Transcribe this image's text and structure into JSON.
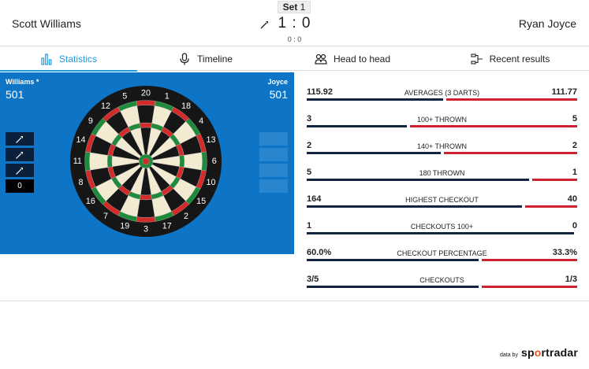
{
  "match": {
    "home_player": "Scott Williams",
    "away_player": "Ryan Joyce",
    "set_prefix": "Set",
    "set_number": "1",
    "score": "1 : 0",
    "leg_score": "0 : 0"
  },
  "tabs": [
    {
      "label": "Statistics",
      "icon": "bar-chart-icon",
      "active": true
    },
    {
      "label": "Timeline",
      "icon": "microphone-icon",
      "active": false
    },
    {
      "label": "Head to head",
      "icon": "people-icon",
      "active": false
    },
    {
      "label": "Recent results",
      "icon": "bracket-icon",
      "active": false
    }
  ],
  "board": {
    "home_name": "Williams *",
    "home_remaining": "501",
    "away_name": "Joyce",
    "away_remaining": "501",
    "home_turn_total": "0",
    "numbers": [
      "20",
      "1",
      "18",
      "4",
      "13",
      "6",
      "10",
      "15",
      "2",
      "17",
      "3",
      "19",
      "7",
      "16",
      "8",
      "11",
      "14",
      "9",
      "12",
      "5"
    ]
  },
  "stats": [
    {
      "label": "AVERAGES (3 DARTS)",
      "home": "115.92",
      "away": "111.77",
      "home_share": 0.509
    },
    {
      "label": "100+ THROWN",
      "home": "3",
      "away": "5",
      "home_share": 0.375
    },
    {
      "label": "140+ THROWN",
      "home": "2",
      "away": "2",
      "home_share": 0.5
    },
    {
      "label": "180 THROWN",
      "home": "5",
      "away": "1",
      "home_share": 0.833
    },
    {
      "label": "HIGHEST CHECKOUT",
      "home": "164",
      "away": "40",
      "home_share": 0.804
    },
    {
      "label": "CHECKOUTS 100+",
      "home": "1",
      "away": "0",
      "home_share": 1.0
    },
    {
      "label": "CHECKOUT PERCENTAGE",
      "home": "60.0%",
      "away": "33.3%",
      "home_share": 0.643
    },
    {
      "label": "CHECKOUTS",
      "home": "3/5",
      "away": "1/3",
      "home_share": 0.643
    }
  ],
  "credit": {
    "prefix": "data by",
    "logo_part1": "sp",
    "logo_accent": "o",
    "logo_part2": "rtradar"
  },
  "colors": {
    "accent": "#1f9ae0",
    "board_panel": "#0d74c6",
    "home_bar": "#12243f",
    "away_bar": "#cf1f32",
    "board_red": "#d32a2a",
    "board_green": "#1e8a3c",
    "board_cream": "#f3ead2",
    "board_black": "#161616"
  }
}
